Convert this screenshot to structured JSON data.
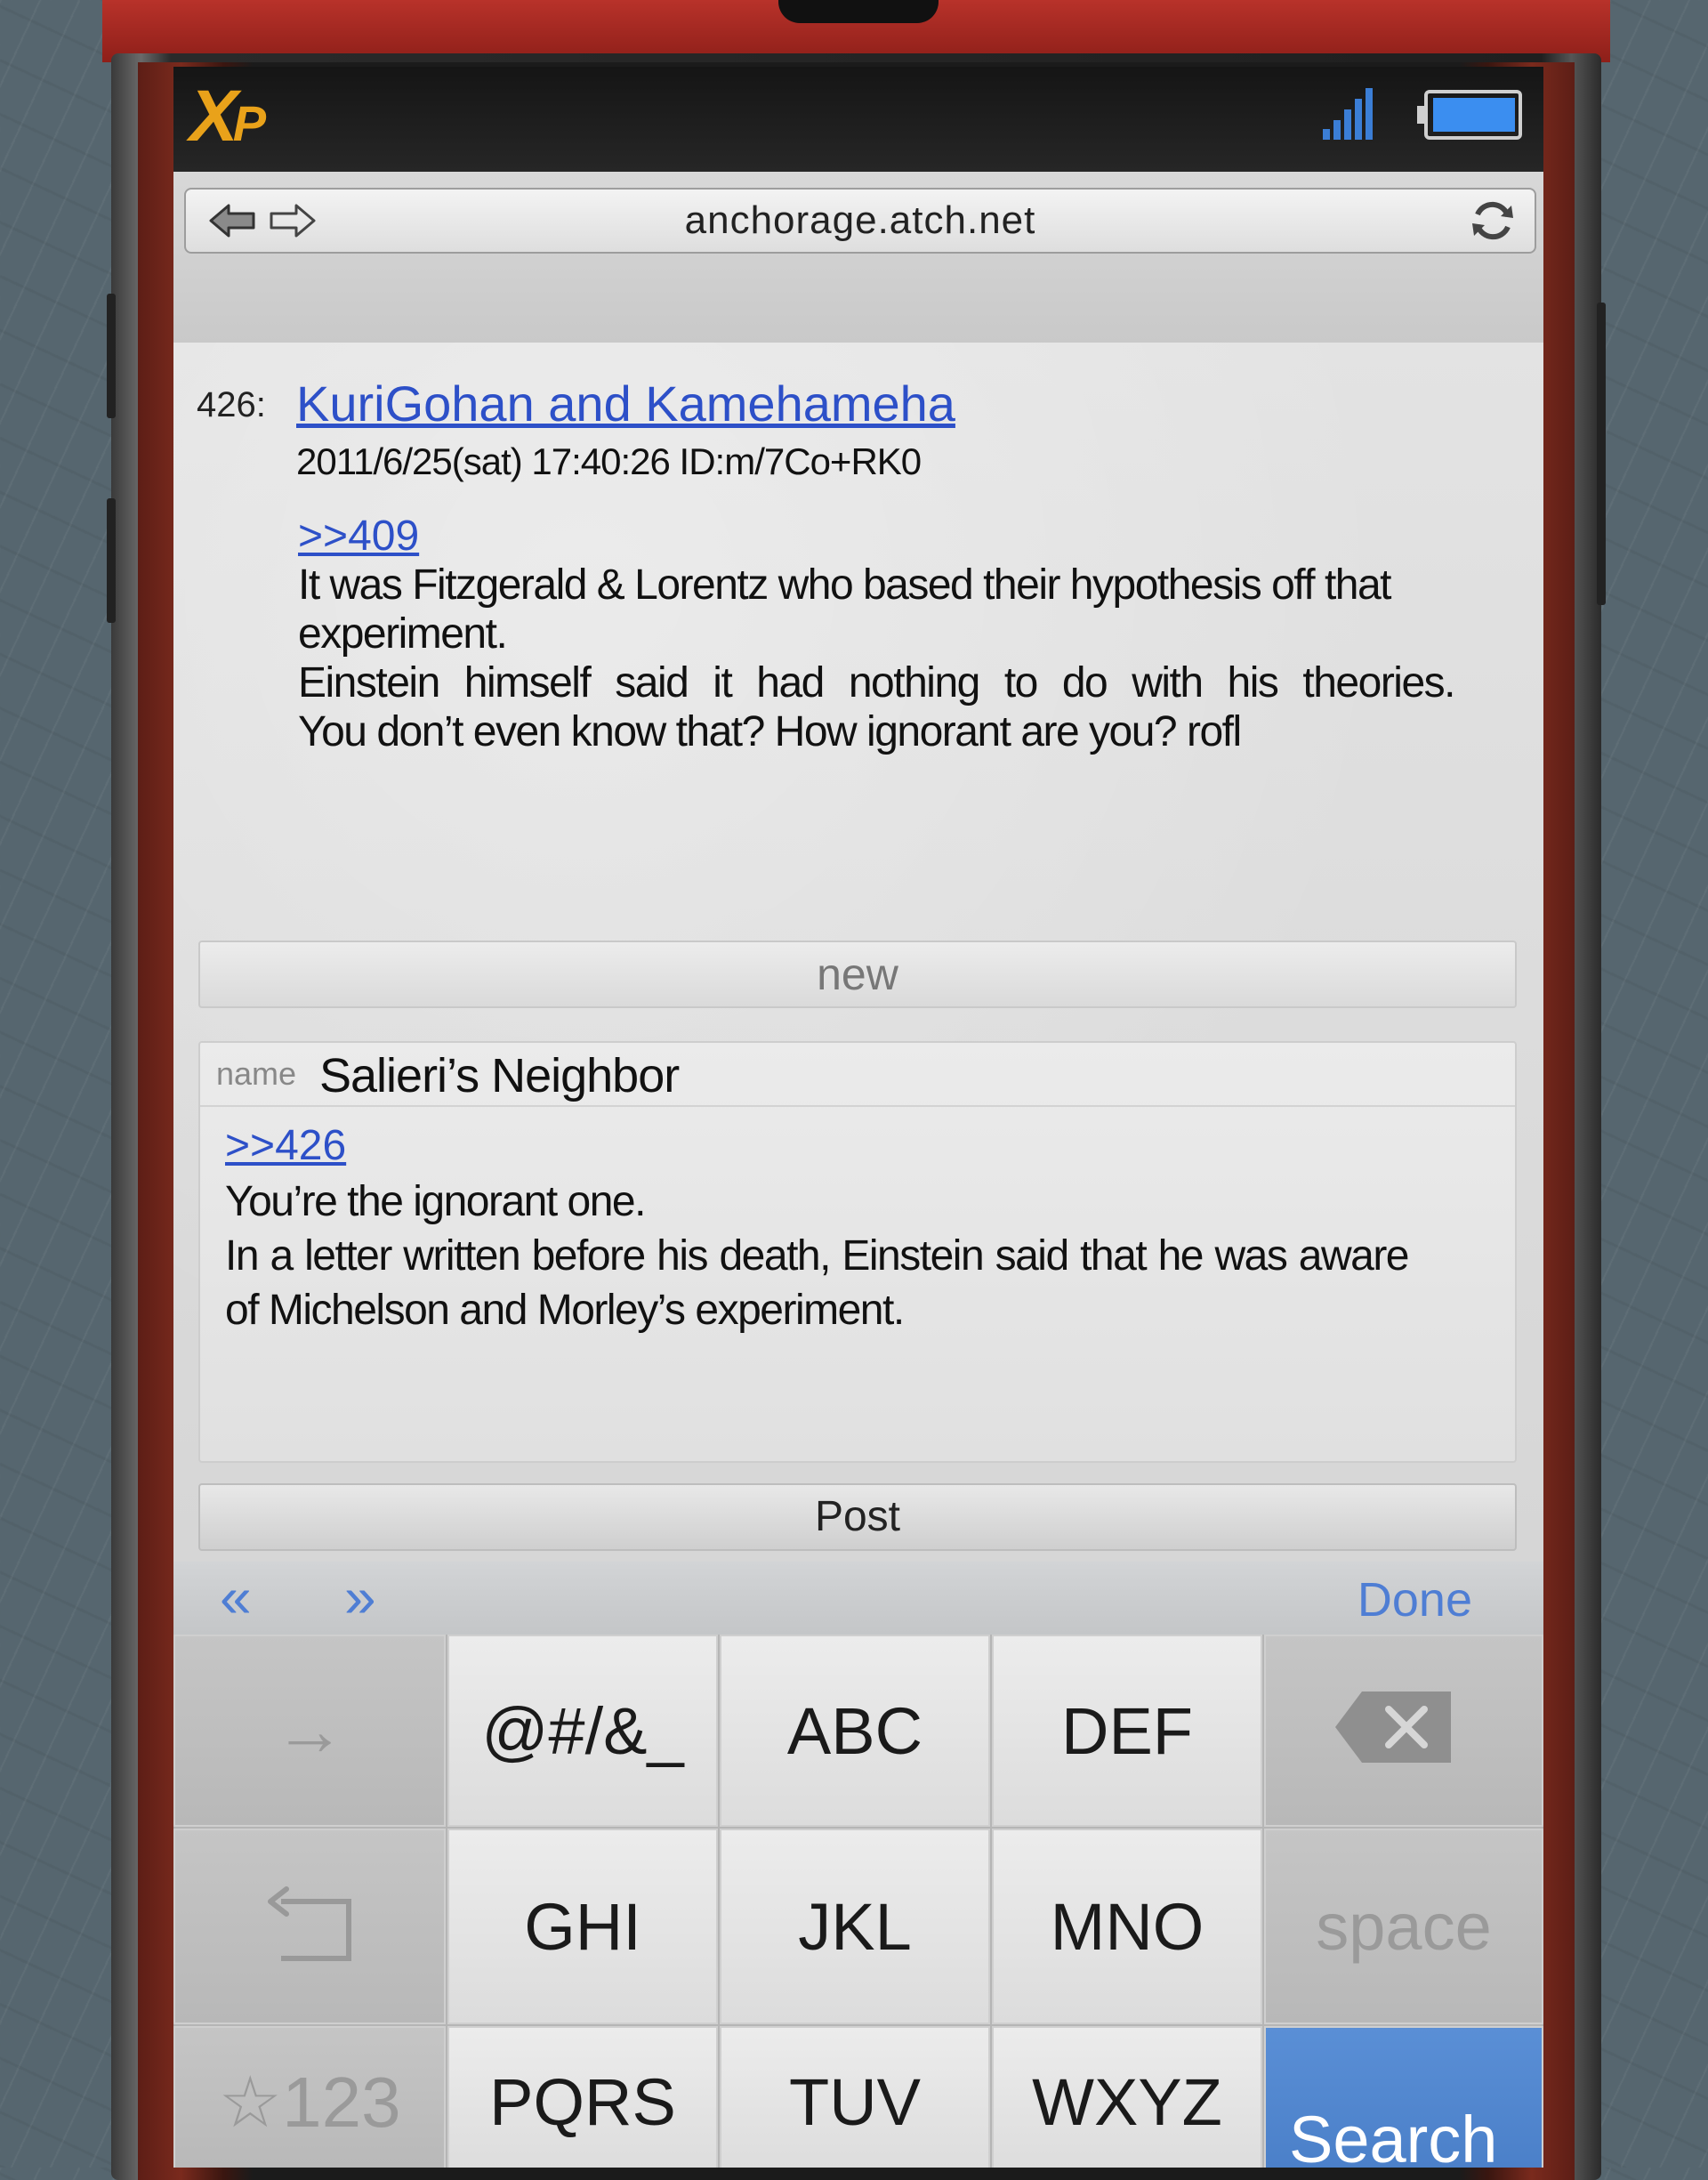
{
  "app": {
    "logo_text": "XP",
    "status": {
      "signal_icon": "signal-bars-icon",
      "battery_icon": "battery-icon"
    }
  },
  "browser": {
    "url": "anchorage.atch.net",
    "back_icon": "back-arrow-icon",
    "forward_icon": "forward-arrow-icon",
    "refresh_icon": "refresh-icon"
  },
  "post": {
    "number": "426:",
    "author": "KuriGohan and Kamehameha",
    "meta": "2011/6/25(sat) 17:40:26 ID:m/7Co+RK0",
    "reply_ref": ">>409",
    "body": [
      "It was Fitzgerald & Lorentz who based their hypothesis off that experiment.",
      "Einstein himself said it had nothing to do with his theories.",
      "You don’t even know that? How ignorant are you? rofl"
    ]
  },
  "new_button": "new",
  "compose": {
    "name_label": "name",
    "name_value": "Salieri’s Neighbor",
    "reply_ref": ">>426",
    "body": [
      "You’re the ignorant one.",
      "In a letter written before his death, Einstein said that he was aware of Michelson and Morley’s experiment."
    ]
  },
  "post_button": "Post",
  "keyboard_toolbar": {
    "prev": "«",
    "next": "»",
    "done": "Done"
  },
  "keyboard": {
    "keys": {
      "arrow": "→",
      "symbols": "@#/&_",
      "abc": "ABC",
      "def": "DEF",
      "backspace_icon": "backspace-icon",
      "undo_icon": "undo-icon",
      "ghi": "GHI",
      "jkl": "JKL",
      "mno": "MNO",
      "space": "space",
      "num": "☆123",
      "pqrs": "PQRS",
      "tuv": "TUV",
      "wxyz": "WXYZ",
      "search": "Search"
    }
  },
  "colors": {
    "link": "#2d50c8",
    "accent_blue": "#4f7ed4",
    "logo_orange": "#e9a21a",
    "phone_red": "#b8322a"
  }
}
